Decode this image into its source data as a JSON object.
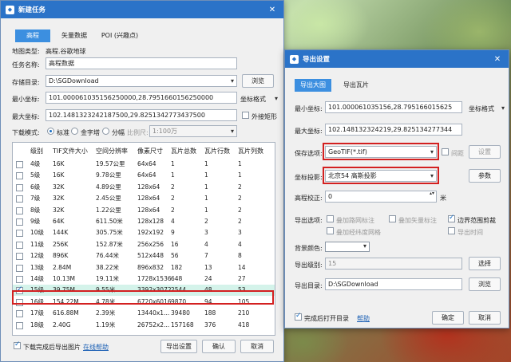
{
  "left": {
    "title": "新建任务",
    "tabs": [
      "高程",
      "矢量数据",
      "POI (兴趣点)"
    ],
    "map_type_label": "地图类型:",
    "map_type_value": "高程.谷歌地球",
    "task_name_label": "任务名称:",
    "task_name_value": "高程数据",
    "store_dir_label": "存储目录:",
    "store_dir_value": "D:\\SGDownload",
    "browse": "浏览",
    "min_coord_label": "最小坐标:",
    "min_coord_value": "101.000061035156250000,28.7951660156250000",
    "coord_format": "坐标格式",
    "max_coord_label": "最大坐标:",
    "max_coord_value": "102.1481323242187500,29.8251342773437500",
    "outer_rect": "外接矩形",
    "download_mode_label": "下载模式:",
    "mode_standard": "标准",
    "mode_pyramid": "金字塔",
    "mode_tile": "分幅",
    "scale_label": "比例尺:",
    "scale_value": "1:100万",
    "columns": [
      "级别",
      "TIF文件大小",
      "空间分辨率",
      "像素尺寸",
      "瓦片总数",
      "瓦片行数",
      "瓦片列数"
    ],
    "rows": [
      {
        "c": [
          "4级",
          "16K",
          "19.57公里",
          "64x64",
          "1",
          "1",
          "1"
        ],
        "checked": false
      },
      {
        "c": [
          "5级",
          "16K",
          "9.78公里",
          "64x64",
          "1",
          "1",
          "1"
        ],
        "checked": false
      },
      {
        "c": [
          "6级",
          "32K",
          "4.89公里",
          "128x64",
          "2",
          "1",
          "2"
        ],
        "checked": false
      },
      {
        "c": [
          "7级",
          "32K",
          "2.45公里",
          "128x64",
          "2",
          "1",
          "2"
        ],
        "checked": false
      },
      {
        "c": [
          "8级",
          "32K",
          "1.22公里",
          "128x64",
          "2",
          "1",
          "2"
        ],
        "checked": false
      },
      {
        "c": [
          "9级",
          "64K",
          "611.50米",
          "128x128",
          "4",
          "2",
          "2"
        ],
        "checked": false
      },
      {
        "c": [
          "10级",
          "144K",
          "305.75米",
          "192x192",
          "9",
          "3",
          "3"
        ],
        "checked": false
      },
      {
        "c": [
          "11级",
          "256K",
          "152.87米",
          "256x256",
          "16",
          "4",
          "4"
        ],
        "checked": false
      },
      {
        "c": [
          "12级",
          "896K",
          "76.44米",
          "512x448",
          "56",
          "7",
          "8"
        ],
        "checked": false
      },
      {
        "c": [
          "13级",
          "2.84M",
          "38.22米",
          "896x832",
          "182",
          "13",
          "14"
        ],
        "checked": false
      },
      {
        "c": [
          "14级",
          "10.13M",
          "19.11米",
          "1728x1536",
          "648",
          "24",
          "27"
        ],
        "checked": false
      },
      {
        "c": [
          "15级",
          "39.75M",
          "9.55米",
          "3392x3072",
          "2544",
          "48",
          "53"
        ],
        "checked": true
      },
      {
        "c": [
          "16级",
          "154.22M",
          "4.78米",
          "6720x6016",
          "9870",
          "94",
          "105"
        ],
        "checked": false
      },
      {
        "c": [
          "17级",
          "616.88M",
          "2.39米",
          "13440x1...",
          "39480",
          "188",
          "210"
        ],
        "checked": false
      },
      {
        "c": [
          "18级",
          "2.40G",
          "1.19米",
          "26752x2...",
          "157168",
          "376",
          "418"
        ],
        "checked": false
      }
    ],
    "export_after": "下载完成后导出图片",
    "online_help": "在线帮助",
    "export_settings": "导出设置",
    "ok": "确认",
    "cancel": "取消"
  },
  "right": {
    "title": "导出设置",
    "tabs": [
      "导出大图",
      "导出瓦片"
    ],
    "min_coord_label": "最小坐标:",
    "min_coord_value": "101.000061035156,28.795166015625",
    "coord_format": "坐标格式",
    "max_coord_label": "最大坐标:",
    "max_coord_value": "102.148132324219,29.825134277344",
    "save_option_label": "保存选项:",
    "save_option_value": "GeoTIF(*.tif)",
    "interval": "间距",
    "settings": "设置",
    "projection_label": "坐标投影:",
    "projection_value": "北京54 高斯投影",
    "params": "参数",
    "elev_label": "高程校正:",
    "elev_value": "0",
    "elev_unit": "米",
    "export_opts_label": "导出选项:",
    "opt_road": "叠加路网标注",
    "opt_vector": "叠加矢量标注",
    "opt_clip": "边界范围剪裁",
    "opt_grid": "叠加经纬度网格",
    "opt_time": "导出时间",
    "bg_label": "背景颜色:",
    "level_label": "导出级别:",
    "level_value": "15",
    "select": "选择",
    "dir_label": "导出目录:",
    "dir_value": "D:\\SGDownload",
    "browse": "浏览",
    "open_after": "完成后打开目录",
    "help": "帮助",
    "ok": "确定",
    "cancel": "取消"
  }
}
